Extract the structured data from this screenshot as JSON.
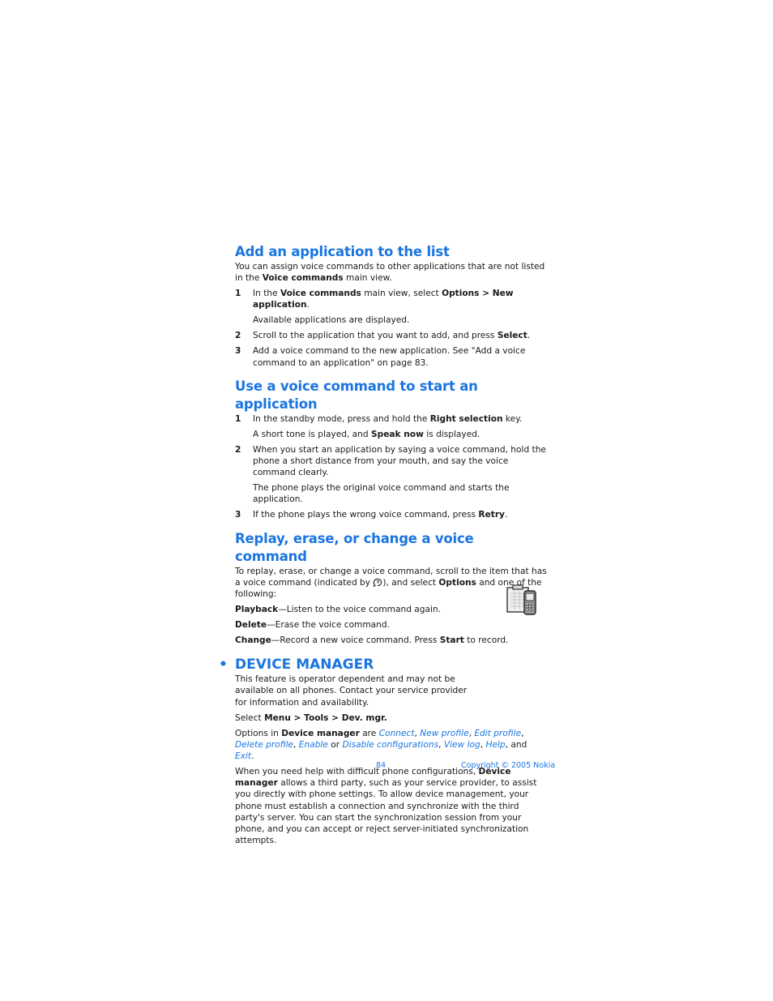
{
  "sections": {
    "add_app": {
      "title": "Add an application to the list",
      "intro_pre": "You can assign voice commands to other applications that are not listed in the ",
      "intro_bold": "Voice commands",
      "intro_post": " main view.",
      "step1": {
        "num": "1",
        "pre": "In the ",
        "b1": "Voice commands",
        "mid": " main view, select ",
        "b2": "Options > New application",
        "post": ".",
        "sub": "Available applications are displayed."
      },
      "step2": {
        "num": "2",
        "pre": "Scroll to the application that you want to add, and press ",
        "b1": "Select",
        "post": "."
      },
      "step3": {
        "num": "3",
        "text": "Add a voice command to the new application. See \"Add a voice command to an application\" on page 83."
      }
    },
    "use_voice": {
      "title": "Use a voice command to start an application",
      "step1": {
        "num": "1",
        "pre": "In the standby mode, press and hold the ",
        "b1": "Right selection",
        "post": " key.",
        "sub_pre": "A short tone is played, and ",
        "sub_b": "Speak now",
        "sub_post": " is displayed."
      },
      "step2": {
        "num": "2",
        "text": "When you start an application by saying a voice command, hold the phone a short distance from your mouth, and say the voice command clearly.",
        "sub": "The phone plays the original voice command and starts the application."
      },
      "step3": {
        "num": "3",
        "pre": "If the phone plays the wrong voice command, press ",
        "b1": "Retry",
        "post": "."
      }
    },
    "replay": {
      "title": "Replay, erase, or change a voice command",
      "intro_pre": "To replay, erase, or change a voice command, scroll to the item that has a voice command (indicated by ",
      "intro_mid": "), and select ",
      "intro_bold": "Options",
      "intro_post": " and one of the following:",
      "icon": "voice-tag-icon",
      "items": [
        {
          "term": "Playback",
          "desc": "—Listen to the voice command again."
        },
        {
          "term": "Delete",
          "desc": "—Erase the voice command."
        },
        {
          "term": "Change",
          "desc": "—Record a new voice command. Press ",
          "b": "Start",
          "post": " to record."
        }
      ]
    },
    "device_manager": {
      "bullet": "•",
      "title": "DEVICE MANAGER",
      "icon": "device-manager-icon",
      "intro": "This feature is operator dependent and may not be available on all phones. Contact your service provider for information and availability.",
      "select_pre": "Select ",
      "select_bold": "Menu > Tools > Dev. mgr.",
      "options_pre": "Options in ",
      "options_bold": "Device manager",
      "options_mid": " are ",
      "options": [
        "Connect",
        "New profile",
        "Edit profile",
        "Delete profile",
        "Enable",
        "Disable configurations",
        "View log",
        "Help",
        "Exit"
      ],
      "sep_comma": ", ",
      "sep_or": " or ",
      "sep_and": ", and ",
      "period": ".",
      "body_pre": "When you need help with difficult phone configurations, ",
      "body_bold": "Device manager",
      "body_post": " allows a third party, such as your service provider, to assist you directly with phone settings. To allow device management, your phone must establish a connection and synchronize with the third party's server. You can start the synchronization session from your phone, and you can accept or reject server-initiated synchronization attempts."
    }
  },
  "footer": {
    "page_number": "84",
    "copyright": "Copyright © 2005 Nokia"
  },
  "colors": {
    "accent": "#1a75e0",
    "text": "#1a1a1a"
  }
}
